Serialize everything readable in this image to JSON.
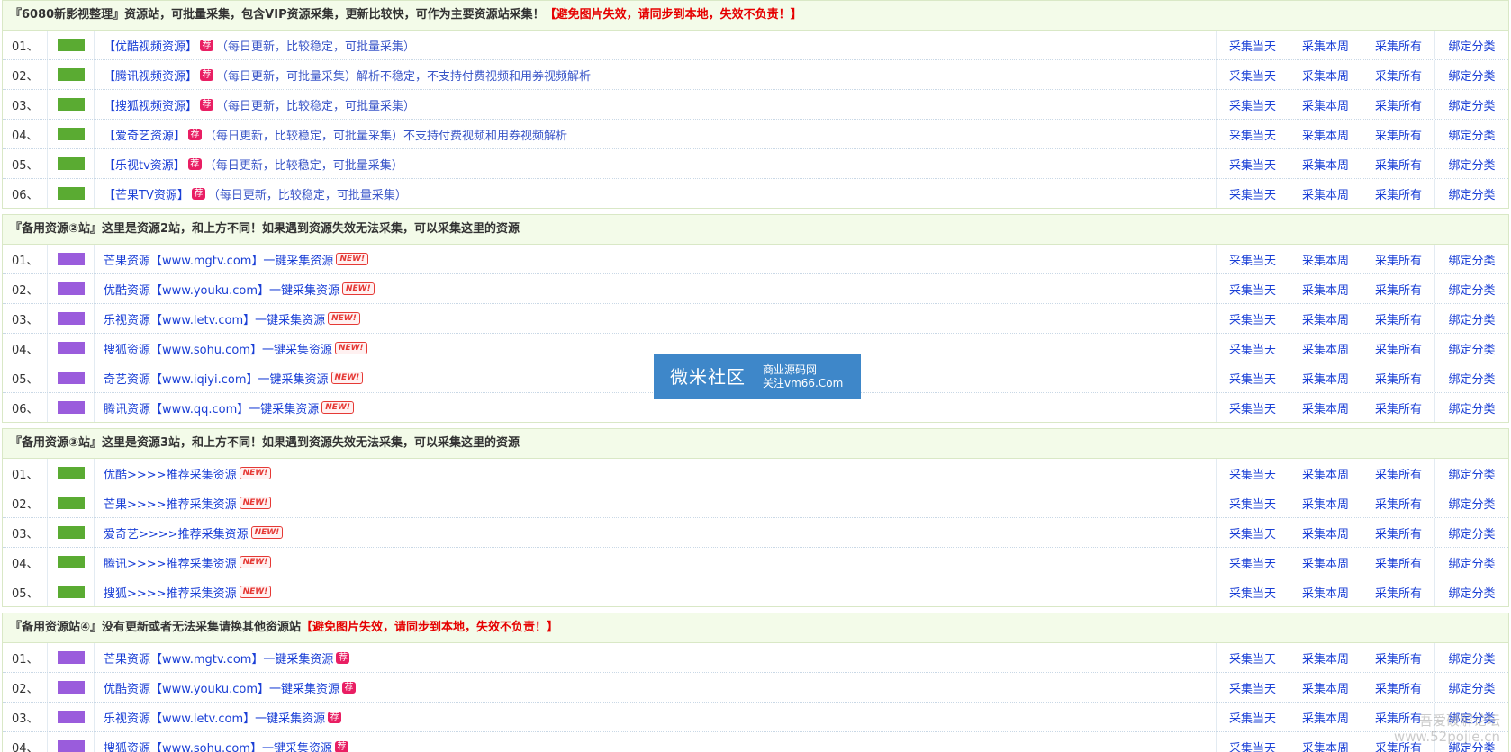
{
  "sections": [
    {
      "title_main": "『6080新影视整理』资源站，可批量采集，包含VIP资源采集，更新比较快，可作为主要资源站采集！",
      "title_warn": "【避免图片失效，请同步到本地，失效不负责！】",
      "swatch": "green",
      "rows": [
        {
          "num": "01、",
          "link": "【优酷视频资源】",
          "badge": "jian",
          "desc": "（每日更新，比较稳定，可批量采集）"
        },
        {
          "num": "02、",
          "link": "【腾讯视频资源】",
          "badge": "jian",
          "desc": "（每日更新，可批量采集）解析不稳定，不支持付费视频和用券视频解析"
        },
        {
          "num": "03、",
          "link": "【搜狐视频资源】",
          "badge": "jian",
          "desc": "（每日更新，比较稳定，可批量采集）"
        },
        {
          "num": "04、",
          "link": "【爱奇艺资源】",
          "badge": "jian",
          "desc": "（每日更新，比较稳定，可批量采集）不支持付费视频和用券视频解析"
        },
        {
          "num": "05、",
          "link": "【乐视tv资源】",
          "badge": "jian",
          "desc": "（每日更新，比较稳定，可批量采集）"
        },
        {
          "num": "06、",
          "link": "【芒果TV资源】",
          "badge": "jian",
          "desc": "（每日更新，比较稳定，可批量采集）"
        }
      ]
    },
    {
      "title_main": "『备用资源②站』这里是资源2站，和上方不同！如果遇到资源失效无法采集，可以采集这里的资源",
      "title_warn": "",
      "swatch": "purple",
      "rows": [
        {
          "num": "01、",
          "link": "芒果资源【www.mgtv.com】一键采集资源",
          "badge": "new",
          "desc": ""
        },
        {
          "num": "02、",
          "link": "优酷资源【www.youku.com】一键采集资源",
          "badge": "new",
          "desc": ""
        },
        {
          "num": "03、",
          "link": "乐视资源【www.letv.com】一键采集资源",
          "badge": "new",
          "desc": ""
        },
        {
          "num": "04、",
          "link": "搜狐资源【www.sohu.com】一键采集资源",
          "badge": "new",
          "desc": ""
        },
        {
          "num": "05、",
          "link": "奇艺资源【www.iqiyi.com】一键采集资源",
          "badge": "new",
          "desc": ""
        },
        {
          "num": "06、",
          "link": "腾讯资源【www.qq.com】一键采集资源",
          "badge": "new",
          "desc": ""
        }
      ]
    },
    {
      "title_main": "『备用资源③站』这里是资源3站，和上方不同！如果遇到资源失效无法采集，可以采集这里的资源",
      "title_warn": "",
      "swatch": "green",
      "rows": [
        {
          "num": "01、",
          "link": "优酷>>>>推荐采集资源",
          "badge": "new",
          "desc": ""
        },
        {
          "num": "02、",
          "link": "芒果>>>>推荐采集资源",
          "badge": "new",
          "desc": ""
        },
        {
          "num": "03、",
          "link": "爱奇艺>>>>推荐采集资源",
          "badge": "new",
          "desc": ""
        },
        {
          "num": "04、",
          "link": "腾讯>>>>推荐采集资源",
          "badge": "new",
          "desc": ""
        },
        {
          "num": "05、",
          "link": "搜狐>>>>推荐采集资源",
          "badge": "new",
          "desc": ""
        }
      ]
    },
    {
      "title_main": "『备用资源站④』没有更新或者无法采集请换其他资源站",
      "title_warn": "【避免图片失效，请同步到本地，失效不负责！】",
      "swatch": "purple",
      "rows": [
        {
          "num": "01、",
          "link": "芒果资源【www.mgtv.com】一键采集资源",
          "badge": "jian",
          "desc": ""
        },
        {
          "num": "02、",
          "link": "优酷资源【www.youku.com】一键采集资源",
          "badge": "jian",
          "desc": ""
        },
        {
          "num": "03、",
          "link": "乐视资源【www.letv.com】一键采集资源",
          "badge": "jian",
          "desc": ""
        },
        {
          "num": "04、",
          "link": "搜狐资源【www.sohu.com】一键采集资源",
          "badge": "jian",
          "desc": ""
        }
      ]
    }
  ],
  "actions": [
    "采集当天",
    "采集本周",
    "采集所有",
    "绑定分类"
  ],
  "badges": {
    "jian": "荐",
    "new": "NEW!"
  },
  "watermark": {
    "big": "微米社区",
    "line1": "商业源码网",
    "line2": "关注vm66.Com"
  },
  "corner_mark": {
    "line1": "吾爱破解论坛",
    "line2": "www.52pojie.cn"
  },
  "colors": {
    "swatch_green": "#5aab32",
    "swatch_purple": "#9a5cdc",
    "link_blue": "#1a3fd6",
    "warn_red": "#e60000",
    "header_bg": "#f3fbe9",
    "watermark_bg": "#3e87c9"
  }
}
